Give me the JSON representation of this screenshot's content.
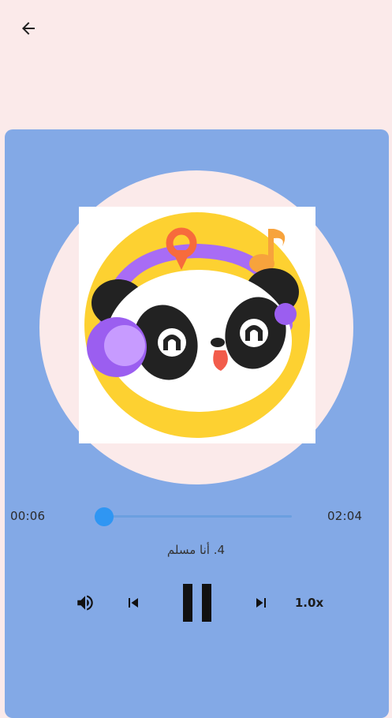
{
  "header": {
    "back_icon": "arrow-left-icon"
  },
  "player": {
    "elapsed": "00:06",
    "total": "02:04",
    "progress_fraction": 0.048,
    "track_title": "4. أنا مسلم",
    "speed_label": "1.0x",
    "controls": [
      "volume-icon",
      "skip-previous-icon",
      "pause-icon",
      "skip-next-icon"
    ],
    "art_icon": "panda-headphones-logo"
  },
  "colors": {
    "background": "#fbeaea",
    "card": "#83a9e6",
    "accent": "#2f96f3",
    "art_yellow": "#fdd131",
    "art_purple": "#a86cf5",
    "art_orange": "#f7a33c"
  }
}
